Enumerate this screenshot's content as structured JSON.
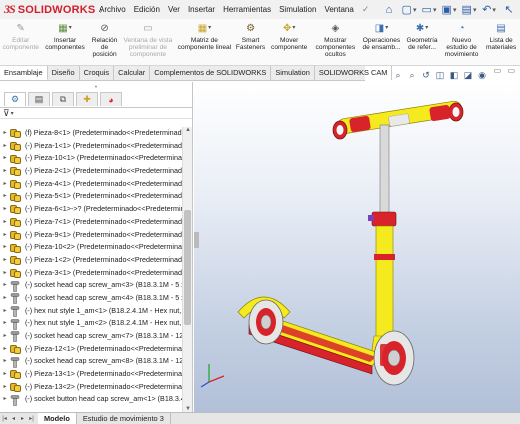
{
  "app": {
    "brand_prefix": "3S",
    "brand_name": "SOLIDWORKS"
  },
  "menu": {
    "items": [
      "Archivo",
      "Edición",
      "Ver",
      "Insertar",
      "Herramientas",
      "Simulation",
      "Ventana"
    ]
  },
  "quick_access": [
    {
      "icon": "home-icon",
      "glyph": "⌂"
    },
    {
      "icon": "new-document-icon",
      "glyph": "▢"
    },
    {
      "icon": "open-folder-icon",
      "glyph": "▭"
    },
    {
      "icon": "save-icon",
      "glyph": "▣"
    },
    {
      "icon": "print-icon",
      "glyph": "▤"
    },
    {
      "icon": "undo-icon",
      "glyph": "↶"
    },
    {
      "icon": "select-arrow-icon",
      "glyph": "↖"
    }
  ],
  "ribbon": {
    "commands": [
      {
        "label": "Editar\ncomponente",
        "disabled": true,
        "icon": "edit-component-icon",
        "glyph": "✎",
        "color": "#9a9a9a"
      },
      {
        "label": "Insertar\ncomponentes",
        "disabled": false,
        "icon": "insert-components-icon",
        "glyph": "▦",
        "color": "#5b8c3a",
        "dropdown": true
      },
      {
        "label": "Relación\nde\nposición",
        "disabled": false,
        "icon": "mate-icon",
        "glyph": "⊘",
        "color": "#555"
      },
      {
        "label": "Ventana de vista\npreliminar de\ncomponente",
        "disabled": true,
        "icon": "component-preview-icon",
        "glyph": "▭",
        "color": "#9a9a9a"
      },
      {
        "label": "Matriz de\ncomponente lineal",
        "disabled": false,
        "icon": "linear-pattern-icon",
        "glyph": "▦",
        "color": "#c9a227",
        "dropdown": true
      },
      {
        "label": "Smart\nFasteners",
        "disabled": false,
        "icon": "smart-fasteners-icon",
        "glyph": "⚙",
        "color": "#7a5a2a"
      },
      {
        "label": "Mover\ncomponente",
        "disabled": false,
        "icon": "move-component-icon",
        "glyph": "✥",
        "color": "#c9a227",
        "dropdown": true
      },
      {
        "label": "Mostrar\ncomponentes\nocultos",
        "disabled": false,
        "icon": "show-hidden-icon",
        "glyph": "◈",
        "color": "#555"
      },
      {
        "label": "Operaciones\nde ensamb...",
        "disabled": false,
        "icon": "assembly-features-icon",
        "glyph": "◨",
        "color": "#3a6fb0",
        "dropdown": true
      },
      {
        "label": "Geometría\nde refer...",
        "disabled": false,
        "icon": "reference-geometry-icon",
        "glyph": "✱",
        "color": "#3a6fb0",
        "dropdown": true
      },
      {
        "label": "Nuevo\nestudio de\nmovimiento",
        "disabled": false,
        "icon": "motion-study-icon",
        "glyph": "◔",
        "color": "#3a6fb0"
      },
      {
        "label": "Lista de\nmateriales",
        "disabled": false,
        "icon": "bill-of-materials-icon",
        "glyph": "▤",
        "color": "#3a6fb0"
      }
    ]
  },
  "command_tabs": {
    "items": [
      "Ensamblaje",
      "Diseño",
      "Croquis",
      "Calcular",
      "Complementos de SOLIDWORKS",
      "Simulation",
      "SOLIDWORKS CAM"
    ],
    "active_index": 0
  },
  "hud": {
    "icons": [
      {
        "icon": "zoom-to-fit-icon",
        "glyph": "⌕"
      },
      {
        "icon": "zoom-area-icon",
        "glyph": "⌕"
      },
      {
        "icon": "previous-view-icon",
        "glyph": "↺"
      },
      {
        "icon": "section-view-icon",
        "glyph": "◫"
      },
      {
        "icon": "view-orientation-icon",
        "glyph": "◧"
      },
      {
        "icon": "display-style-icon",
        "glyph": "◪"
      },
      {
        "icon": "hide-show-icon",
        "glyph": "◉"
      }
    ]
  },
  "panel": {
    "tabs": [
      {
        "icon": "feature-manager-icon",
        "glyph": "⚙"
      },
      {
        "icon": "property-manager-icon",
        "glyph": "▤"
      },
      {
        "icon": "configuration-manager-icon",
        "glyph": "⧉"
      },
      {
        "icon": "dimxpert-icon",
        "glyph": "✚"
      },
      {
        "icon": "display-manager-icon",
        "glyph": "◕"
      }
    ],
    "active_tab": 0,
    "filter_icon": "filter-icon"
  },
  "tree": {
    "rows": [
      {
        "type": "part",
        "text": "(f) Pieza-8<1> (Predeterminado<<Predeterminad"
      },
      {
        "type": "part",
        "text": "(-) Pieza-1<1> (Predeterminado<<Predeterminad"
      },
      {
        "type": "part",
        "text": "(-) Pieza-10<1> (Predeterminado<<Predetermina"
      },
      {
        "type": "part",
        "text": "(-) Pieza-2<1> (Predeterminado<<Predeterminad"
      },
      {
        "type": "part",
        "text": "(-) Pieza-4<1> (Predeterminado<<Predeterminad"
      },
      {
        "type": "part",
        "text": "(-) Pieza-5<1> (Predeterminado<<Predeterminad"
      },
      {
        "type": "part",
        "text": "(-) Pieza-6<1>->? (Predeterminado<<Predetermina"
      },
      {
        "type": "part",
        "text": "(-) Pieza-7<1> (Predeterminado<<Predeterminad"
      },
      {
        "type": "part",
        "text": "(-) Pieza-9<1> (Predeterminado<<Predeterminad"
      },
      {
        "type": "part",
        "text": "(-) Pieza-10<2> (Predeterminado<<Predetermina"
      },
      {
        "type": "part",
        "text": "(-) Pieza-1<2> (Predeterminado<<Predeterminad"
      },
      {
        "type": "part",
        "text": "(-) Pieza-3<1> (Predeterminado<<Predeterminad"
      },
      {
        "type": "bolt",
        "text": "(-) socket head cap screw_am<3> (B18.3.1M - 5 x"
      },
      {
        "type": "bolt",
        "text": "(-) socket head cap screw_am<4> (B18.3.1M - 5 x"
      },
      {
        "type": "bolt",
        "text": "(-) hex nut style 1_am<1> (B18.2.4.1M - Hex nut, S"
      },
      {
        "type": "bolt",
        "text": "(-) hex nut style 1_am<2> (B18.2.4.1M - Hex nut, S"
      },
      {
        "type": "bolt",
        "text": "(-) socket head cap screw_am<7> (B18.3.1M - 12 :"
      },
      {
        "type": "part",
        "text": "(-) Pieza-12<1> (Predeterminado<<Predetermina"
      },
      {
        "type": "bolt",
        "text": "(-) socket head cap screw_am<8> (B18.3.1M - 12 :"
      },
      {
        "type": "part",
        "text": "(-) Pieza-13<1> (Predeterminado<<Predetermina"
      },
      {
        "type": "part",
        "text": "(-) Pieza-13<2> (Predeterminado<<Predetermina"
      },
      {
        "type": "bolt",
        "text": "(-) socket button head cap screw_am<1> (B18.3.4 ."
      }
    ]
  },
  "bottom_tabs": {
    "items": [
      "Modelo",
      "Estudio de movimiento 3"
    ],
    "active_index": 0
  },
  "colors": {
    "scooter_yellow": "#f5ea1e",
    "scooter_red": "#d8232a",
    "wheel_grey": "#c8c8c8",
    "brand_red": "#d0202e"
  }
}
